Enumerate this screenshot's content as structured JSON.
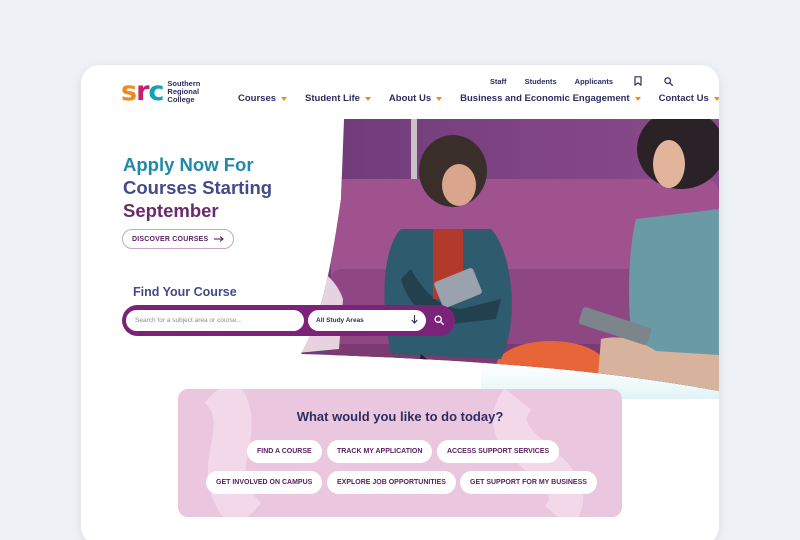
{
  "colors": {
    "accent_orange": "#ef8a1e",
    "brand_purple": "#7a2378",
    "navy": "#2b2f5f",
    "panel_pink": "#ebc6df"
  },
  "logo": {
    "mark": {
      "s": "s",
      "r": "r",
      "c": "c"
    },
    "lines": [
      "Southern",
      "Regional",
      "College"
    ]
  },
  "utility": {
    "links": [
      "Staff",
      "Students",
      "Applicants"
    ],
    "icons": [
      "bookmark-icon",
      "search-icon"
    ]
  },
  "nav": {
    "items": [
      {
        "label": "Courses"
      },
      {
        "label": "Student Life"
      },
      {
        "label": "About Us"
      },
      {
        "label": "Business and Economic Engagement"
      },
      {
        "label": "Contact Us"
      }
    ]
  },
  "hero": {
    "title_lines": [
      "Apply Now For",
      "Courses Starting",
      "September"
    ],
    "cta_label": "DISCOVER COURSES",
    "cta_icon": "arrow-right-icon"
  },
  "search": {
    "heading": "Find Your Course",
    "placeholder": "Search for a subject area or course...",
    "area_selected": "All Study Areas",
    "area_icon": "arrow-down-icon",
    "button_icon": "search-icon"
  },
  "tasks": {
    "heading": "What would you like to do today?",
    "row1": [
      "FIND A COURSE",
      "TRACK MY APPLICATION",
      "ACCESS SUPPORT SERVICES"
    ],
    "row2": [
      "GET INVOLVED ON CAMPUS",
      "EXPLORE JOB OPPORTUNITIES",
      "GET SUPPORT FOR MY BUSINESS"
    ]
  }
}
